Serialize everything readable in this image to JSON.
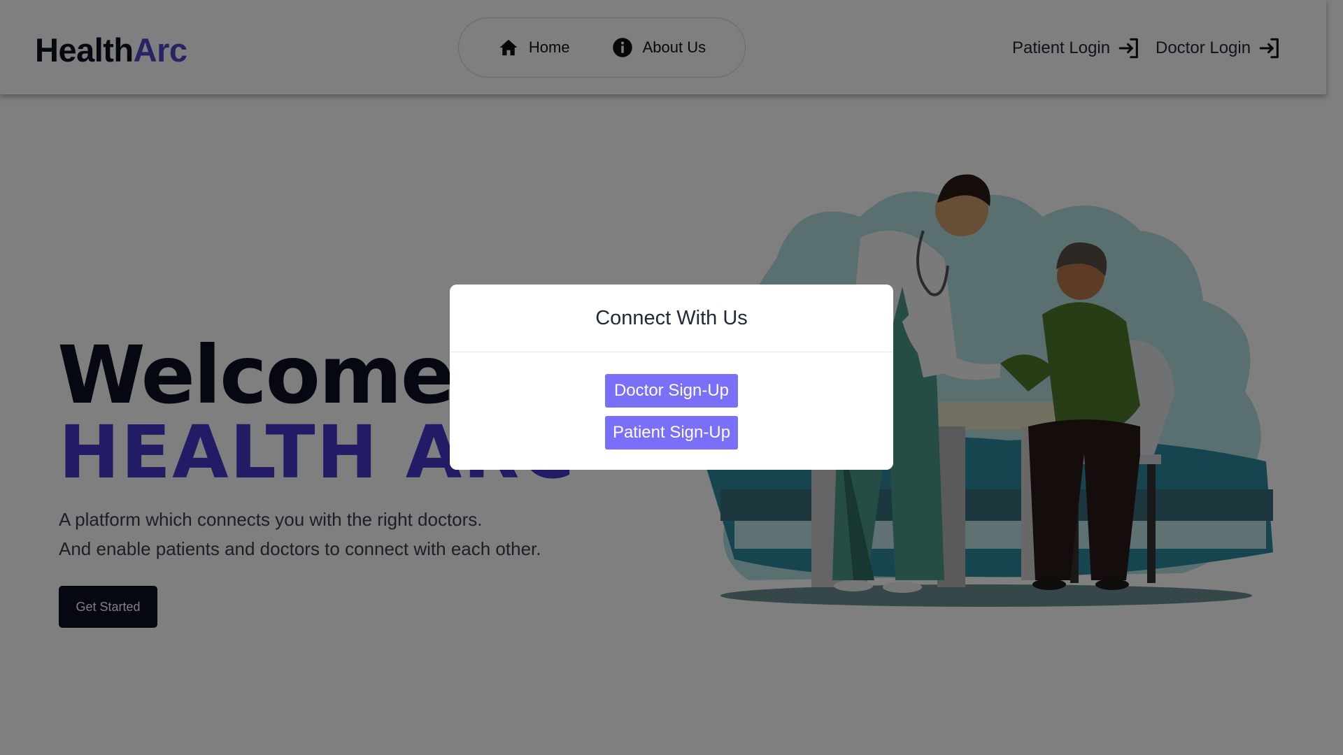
{
  "header": {
    "logo_part1": "Health",
    "logo_part2": "Arc",
    "nav": [
      {
        "label": "Home",
        "icon": "home-icon"
      },
      {
        "label": "About Us",
        "icon": "info-icon"
      }
    ],
    "patient_login": "Patient Login",
    "doctor_login": "Doctor Login"
  },
  "hero": {
    "title_line1": "Welcome To",
    "title_line2": "HEALTH ARC",
    "subtitle_line1": "A platform which connects you with the right doctors.",
    "subtitle_line2": "And enable patients and doctors to connect with each other.",
    "cta_label": "Get Started",
    "illustration": "doctor-checking-patient-illustration"
  },
  "modal": {
    "title": "Connect With Us",
    "doctor_signup": "Doctor Sign-Up",
    "patient_signup": "Patient Sign-Up"
  },
  "colors": {
    "brand_dark": "#0b1120",
    "brand_accent": "#4338ca",
    "signup_button": "#7a6ff8",
    "overlay": "rgba(0,0,0,0.5)"
  }
}
